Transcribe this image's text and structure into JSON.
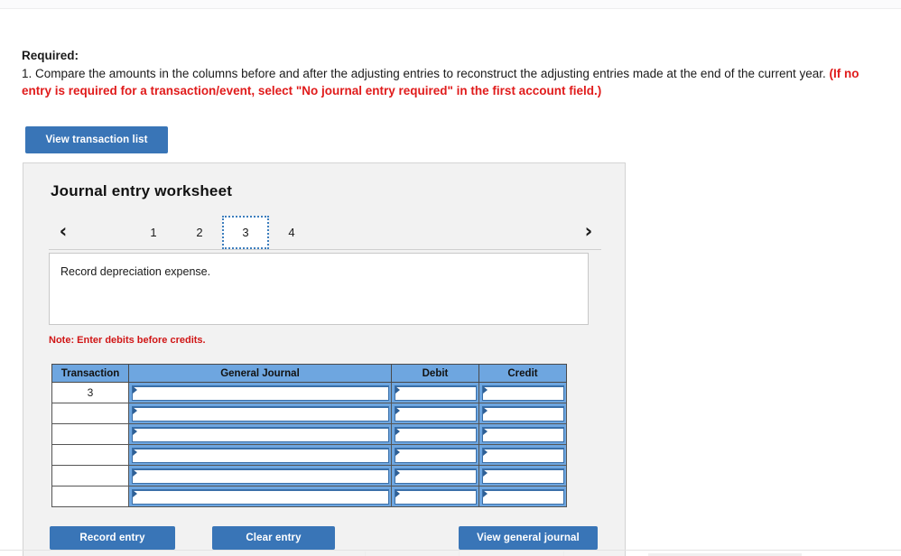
{
  "required": {
    "label": "Required:",
    "line1": "1. Compare the amounts in the columns before and after the adjusting entries to reconstruct the adjusting entries made at the end of the current year. ",
    "emphasis": "(If no entry is required for a transaction/event, select \"No journal entry required\" in the first account field.)"
  },
  "toolbar": {
    "view_transaction_list_label": "View transaction list"
  },
  "panel": {
    "title": "Journal entry worksheet",
    "pager": {
      "prev_icon": "chevron-left-icon",
      "next_icon": "chevron-right-icon",
      "prev_glyph": "‹",
      "next_glyph": "›",
      "tabs": [
        "1",
        "2",
        "3",
        "4"
      ],
      "active_tab": "3"
    },
    "description": "Record depreciation expense.",
    "note": "Note: Enter debits before credits.",
    "table": {
      "headers": [
        "Transaction",
        "General Journal",
        "Debit",
        "Credit"
      ],
      "rows": [
        {
          "transaction": "3",
          "general_journal": "",
          "debit": "",
          "credit": ""
        },
        {
          "transaction": "",
          "general_journal": "",
          "debit": "",
          "credit": ""
        },
        {
          "transaction": "",
          "general_journal": "",
          "debit": "",
          "credit": ""
        },
        {
          "transaction": "",
          "general_journal": "",
          "debit": "",
          "credit": ""
        },
        {
          "transaction": "",
          "general_journal": "",
          "debit": "",
          "credit": ""
        },
        {
          "transaction": "",
          "general_journal": "",
          "debit": "",
          "credit": ""
        }
      ]
    },
    "actions": {
      "record_entry_label": "Record entry",
      "clear_entry_label": "Clear entry",
      "view_general_journal_label": "View general journal"
    }
  },
  "colors": {
    "button_blue": "#3975b7",
    "header_blue": "#6ea6e0",
    "alert_red": "#d01616",
    "panel_gray": "#f2f2f2"
  }
}
